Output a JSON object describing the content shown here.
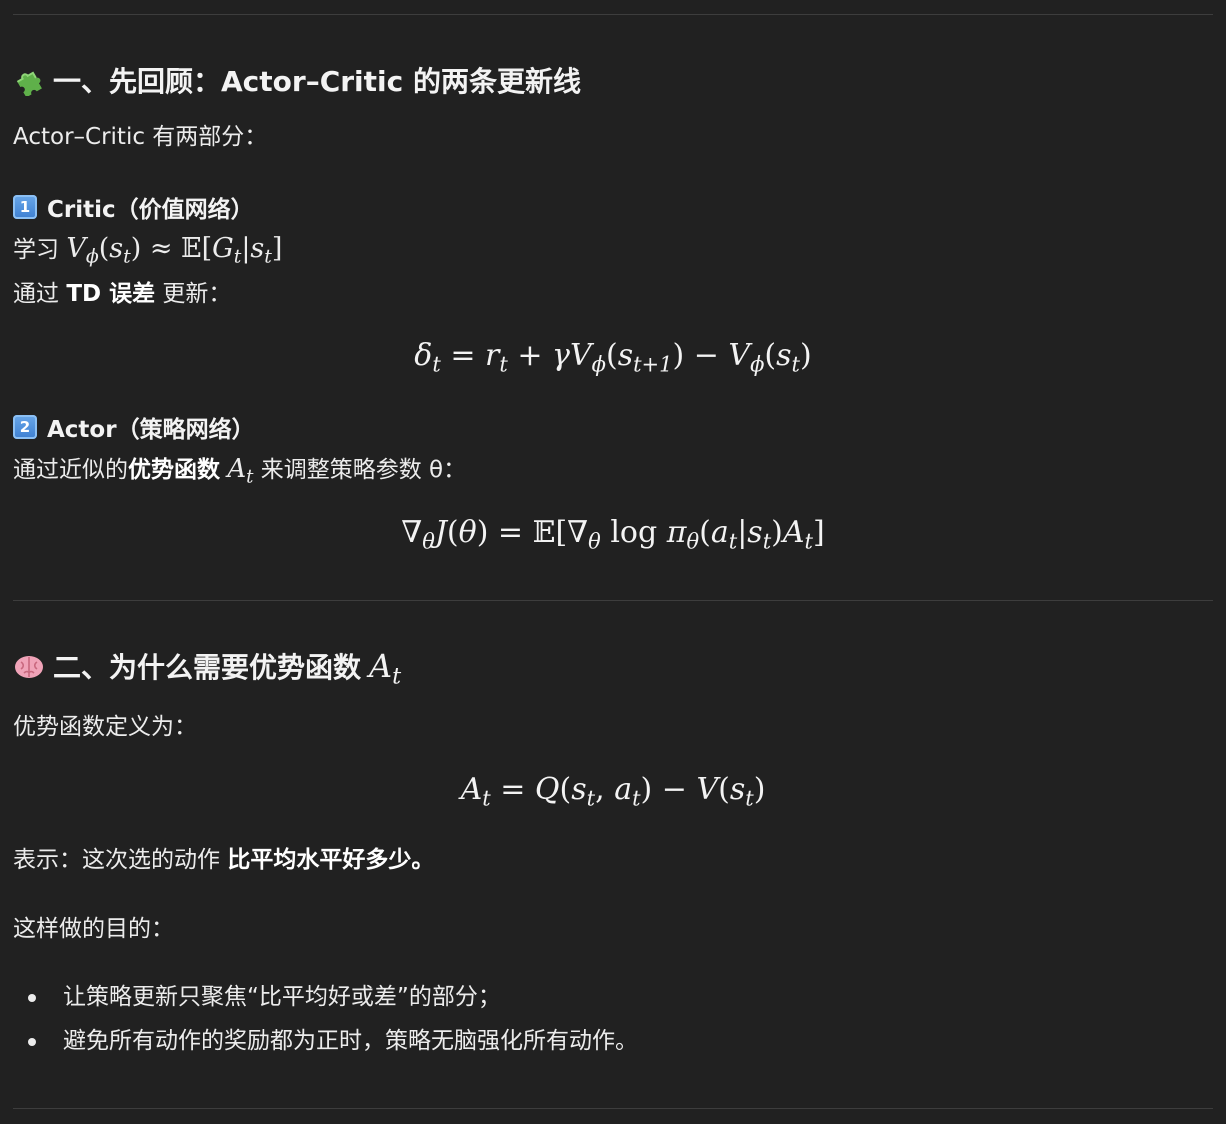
{
  "section1": {
    "title": "一、先回顾：Actor–Critic 的两条更新线",
    "icon": "puzzle-piece-icon",
    "intro": "Actor–Critic 有两部分：",
    "critic": {
      "keycap": "1",
      "title": "Critic（价值网络）",
      "learn_prefix": "学习 ",
      "update_prefix": "通过 ",
      "update_bold": "TD 误差",
      "update_suffix": " 更新：",
      "equation": "δt = rt + γVϕ(st+1) − Vϕ(st)"
    },
    "actor": {
      "keycap": "2",
      "title": "Actor（策略网络）",
      "text_prefix": "通过近似的",
      "text_bold": "优势函数",
      "text_suffix": " 来调整策略参数 θ：",
      "equation": "∇θJ(θ) = E[∇θ log πθ(at|st)At]"
    }
  },
  "section2": {
    "title": "二、为什么需要优势函数 ",
    "icon": "brain-icon",
    "definition_intro": "优势函数定义为：",
    "equation": "At = Q(st, at) − V(st)",
    "meaning_prefix": "表示：这次选的动作 ",
    "meaning_bold": "比平均水平好多少。",
    "purpose_intro": "这样做的目的：",
    "bullets": [
      "让策略更新只聚焦“比平均好或差”的部分；",
      "避免所有动作的奖励都为正时，策略无脑强化所有动作。"
    ]
  },
  "colors": {
    "background": "#212121",
    "text": "#ececec",
    "divider": "#3d3d3d",
    "keycap": "#4a8ddc"
  }
}
